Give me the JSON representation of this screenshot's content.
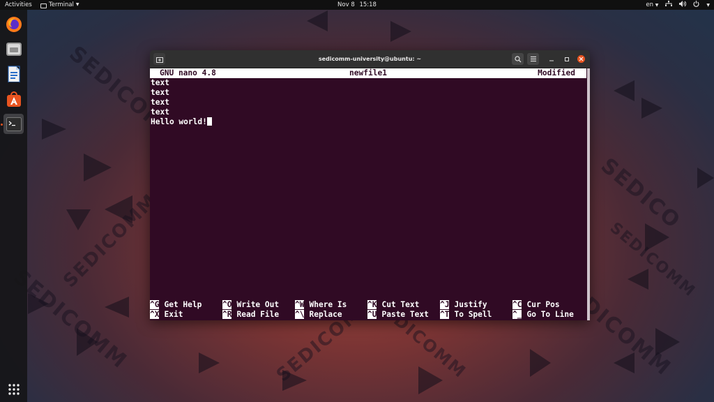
{
  "topbar": {
    "activities": "Activities",
    "app_name": "Terminal",
    "date": "Nov 8",
    "time": "15:18",
    "language": "en"
  },
  "dock": {
    "items": [
      "firefox-icon",
      "files-icon",
      "writer-icon",
      "software-icon",
      "terminal-icon",
      "show-apps-icon"
    ]
  },
  "window": {
    "title": "sedicomm-university@ubuntu: ~"
  },
  "nano": {
    "version": "GNU nano 4.8",
    "filename": "newfile1",
    "status": "Modified",
    "lines": [
      "text",
      "text",
      "text",
      "text",
      "Hello world!"
    ],
    "shortcuts_row1": [
      {
        "key": "^G",
        "label": "Get Help"
      },
      {
        "key": "^O",
        "label": "Write Out"
      },
      {
        "key": "^W",
        "label": "Where Is"
      },
      {
        "key": "^K",
        "label": "Cut Text"
      },
      {
        "key": "^J",
        "label": "Justify"
      },
      {
        "key": "^C",
        "label": "Cur Pos"
      }
    ],
    "shortcuts_row2": [
      {
        "key": "^X",
        "label": "Exit"
      },
      {
        "key": "^R",
        "label": "Read File"
      },
      {
        "key": "^\\",
        "label": "Replace"
      },
      {
        "key": "^U",
        "label": "Paste Text"
      },
      {
        "key": "^T",
        "label": "To Spell"
      },
      {
        "key": "^_",
        "label": "Go To Line"
      }
    ]
  },
  "colors": {
    "terminal_bg": "#300a24",
    "accent": "#e95420",
    "topbar": "#101010"
  }
}
